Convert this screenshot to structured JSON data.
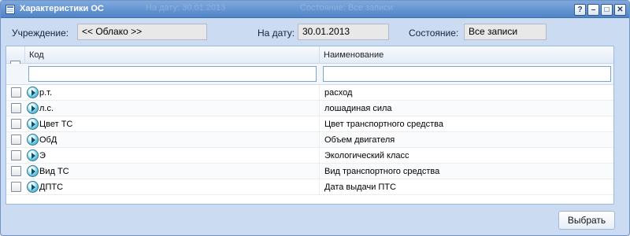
{
  "window": {
    "title": "Характеристики ОС",
    "background_ghost": {
      "date_text": "На дату: 30.01.2013",
      "state_text": "Состояние: Все записи"
    },
    "tools": [
      {
        "name": "help-button",
        "glyph": "?"
      },
      {
        "name": "minimize-button",
        "glyph": "–"
      },
      {
        "name": "maximize-button",
        "glyph": "□"
      },
      {
        "name": "close-button",
        "glyph": "✕"
      }
    ]
  },
  "filters": {
    "institution_label": "Учреждение:",
    "institution_value": "<< Облако >>",
    "date_label": "На дату:",
    "date_value": "30.01.2013",
    "state_label": "Состояние:",
    "state_value": "Все записи"
  },
  "grid": {
    "columns": [
      "Код",
      "Наименование"
    ],
    "filter_values": [
      "",
      ""
    ],
    "rows": [
      {
        "code": "р.т.",
        "name": "расход"
      },
      {
        "code": "л.с.",
        "name": "лошадиная сила"
      },
      {
        "code": "Цвет ТС",
        "name": "Цвет транспортного средства"
      },
      {
        "code": "ОбД",
        "name": "Объем двигателя"
      },
      {
        "code": "Э",
        "name": "Экологический класс"
      },
      {
        "code": "Вид ТС",
        "name": "Вид транспортного средства"
      },
      {
        "code": "ДПТС",
        "name": "Дата выдачи ПТС"
      }
    ]
  },
  "footer": {
    "select_label": "Выбрать"
  },
  "colors": {
    "titlebar": "#5a8dd0",
    "window_bg": "#cbdcf2",
    "grid_border": "#99bbe8"
  }
}
